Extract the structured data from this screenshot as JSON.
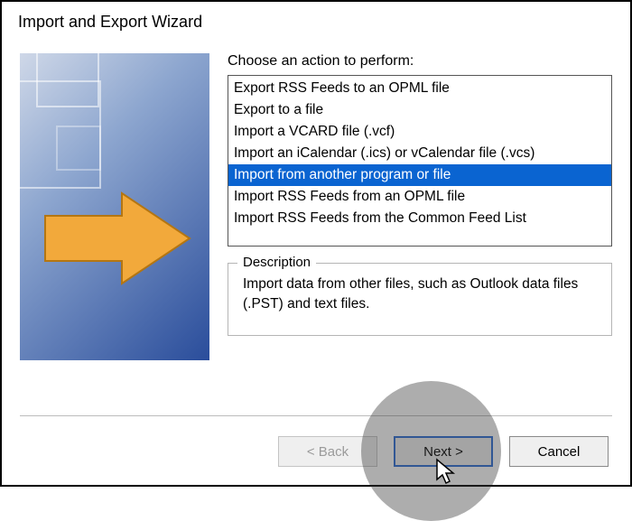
{
  "window": {
    "title": "Import and Export Wizard"
  },
  "prompt": "Choose an action to perform:",
  "options": [
    "Export RSS Feeds to an OPML file",
    "Export to a file",
    "Import a VCARD file (.vcf)",
    "Import an iCalendar (.ics) or vCalendar file (.vcs)",
    "Import from another program or file",
    "Import RSS Feeds from an OPML file",
    "Import RSS Feeds from the Common Feed List"
  ],
  "selected_index": 4,
  "description": {
    "legend": "Description",
    "text": "Import data from other files, such as Outlook data files (.PST) and text files."
  },
  "buttons": {
    "back": "< Back",
    "next": "Next >",
    "cancel": "Cancel"
  }
}
